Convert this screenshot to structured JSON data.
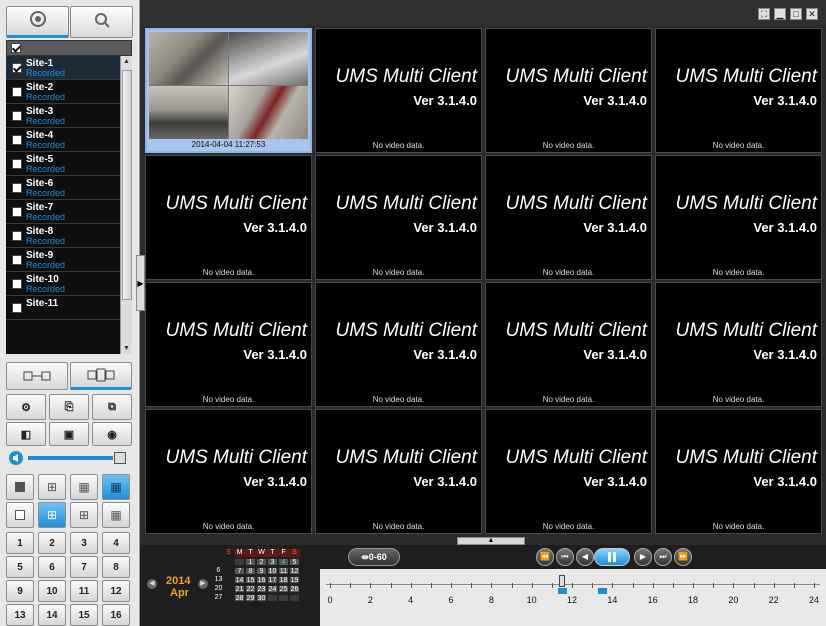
{
  "left_panel": {
    "top_tabs": [
      {
        "icon": "camera-tree-icon",
        "selected": true
      },
      {
        "icon": "search-icon",
        "selected": false
      }
    ],
    "sites": [
      {
        "name": "Site-1",
        "status": "Recorded",
        "checked": true,
        "selected": true
      },
      {
        "name": "Site-2",
        "status": "Recorded",
        "checked": false,
        "selected": false
      },
      {
        "name": "Site-3",
        "status": "Recorded",
        "checked": false,
        "selected": false
      },
      {
        "name": "Site-4",
        "status": "Recorded",
        "checked": false,
        "selected": false
      },
      {
        "name": "Site-5",
        "status": "Recorded",
        "checked": false,
        "selected": false
      },
      {
        "name": "Site-6",
        "status": "Recorded",
        "checked": false,
        "selected": false
      },
      {
        "name": "Site-7",
        "status": "Recorded",
        "checked": false,
        "selected": false
      },
      {
        "name": "Site-8",
        "status": "Recorded",
        "checked": false,
        "selected": false
      },
      {
        "name": "Site-9",
        "status": "Recorded",
        "checked": false,
        "selected": false
      },
      {
        "name": "Site-10",
        "status": "Recorded",
        "checked": false,
        "selected": false
      },
      {
        "name": "Site-11",
        "status": "",
        "checked": false,
        "selected": false
      }
    ],
    "channel_numbers": [
      "1",
      "2",
      "3",
      "4",
      "5",
      "6",
      "7",
      "8",
      "9",
      "10",
      "11",
      "12",
      "13",
      "14",
      "15",
      "16"
    ],
    "volume_fraction": 0.85
  },
  "video": {
    "watermark_title": "UMS Multi Client",
    "watermark_version": "Ver 3.1.4.0",
    "no_video_label": "No video data.",
    "active_timestamp": "2014-04-04 11:27:53"
  },
  "calendar": {
    "year": "2014",
    "month": "Apr",
    "weekdays": [
      "S",
      "M",
      "T",
      "W",
      "T",
      "F",
      "S"
    ],
    "week_labels": [
      "",
      "6",
      "13",
      "20",
      "27"
    ],
    "rows": [
      [
        "",
        "",
        "1",
        "2",
        "3",
        "4",
        "5"
      ],
      [
        "",
        "7",
        "8",
        "9",
        "10",
        "11",
        "12"
      ],
      [
        "",
        "14",
        "15",
        "16",
        "17",
        "18",
        "19"
      ],
      [
        "",
        "21",
        "22",
        "23",
        "24",
        "25",
        "26"
      ],
      [
        "",
        "28",
        "29",
        "30",
        "",
        "",
        ""
      ]
    ],
    "highlight_day": "4"
  },
  "timeline": {
    "range_label": "0-60",
    "hour_labels": [
      "0",
      "2",
      "4",
      "6",
      "8",
      "10",
      "12",
      "14",
      "16",
      "18",
      "20",
      "22",
      "24"
    ],
    "cursor_hour": 11.5,
    "record_segments": [
      11.5,
      13.5
    ],
    "colors": {
      "accent": "#1a8fd8",
      "highlight": "#f0a020"
    }
  }
}
